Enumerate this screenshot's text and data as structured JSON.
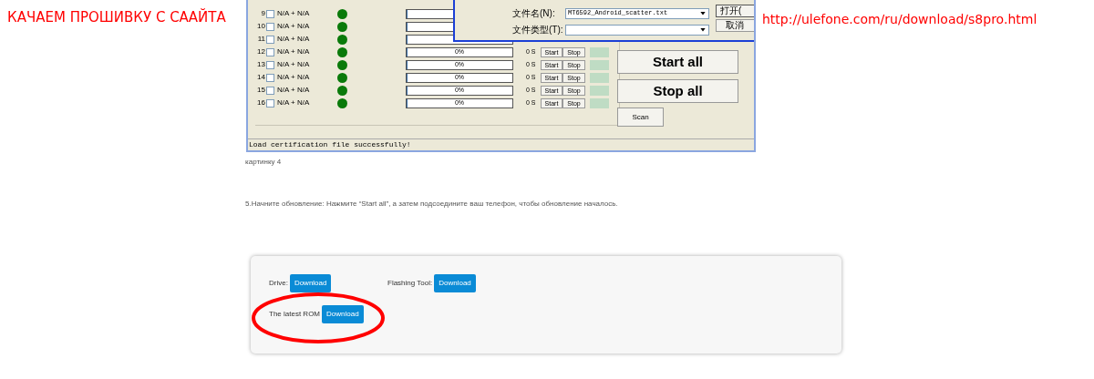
{
  "left_note": "КАЧАЕМ ПРОШИВКУ С СААЙТА",
  "right_note": "http://ulefone.com/ru/download/s8pro.html",
  "flash_tool": {
    "ports": [
      {
        "number": "9",
        "checked": false,
        "label": "N/A + N/A",
        "level": 0
      },
      {
        "number": "10",
        "checked": false,
        "label": "N/A + N/A",
        "level": 0
      },
      {
        "number": "11",
        "checked": false,
        "label": "N/A + N/A",
        "level": 0
      },
      {
        "number": "12",
        "checked": false,
        "label": "N/A + N/A",
        "level": 0,
        "progress": "0%",
        "time": "0 S",
        "start": "Start",
        "stop": "Stop"
      },
      {
        "number": "13",
        "checked": false,
        "label": "N/A + N/A",
        "level": 0,
        "progress": "0%",
        "time": "0 S",
        "start": "Start",
        "stop": "Stop"
      },
      {
        "number": "14",
        "checked": false,
        "label": "N/A + N/A",
        "level": 0,
        "progress": "0%",
        "time": "0 S",
        "start": "Start",
        "stop": "Stop"
      },
      {
        "number": "15",
        "checked": false,
        "label": "N/A + N/A",
        "level": 0,
        "progress": "0%",
        "time": "0 S",
        "start": "Start",
        "stop": "Stop"
      },
      {
        "number": "16",
        "checked": false,
        "label": "N/A + N/A",
        "level": 0,
        "progress": "0%",
        "time": "0 S",
        "start": "Start",
        "stop": "Stop"
      }
    ],
    "start_all": "Start all",
    "stop_all": "Stop all",
    "scan": "Scan",
    "status": "Load certification file successfully!",
    "file_dialog": {
      "file_name_label": "文件名(N):",
      "file_name": "MT6592_Android_scatter.txt",
      "file_type_label": "文件类型(T):",
      "open": "打开(",
      "cancel": "取消"
    }
  },
  "caption": "картинку 4",
  "instruction": "5.Начните обновление: Нажмите “Start all”, а затем подсоедините ваш телефон, чтобы обновление началось.",
  "downloads": [
    {
      "label": "Drive:",
      "button": "Download",
      "highlighted": false
    },
    {
      "label": "Flashing Tool:",
      "button": "Download",
      "highlighted": false
    },
    {
      "label": "The latest ROM",
      "button": "Download",
      "highlighted": true
    }
  ]
}
